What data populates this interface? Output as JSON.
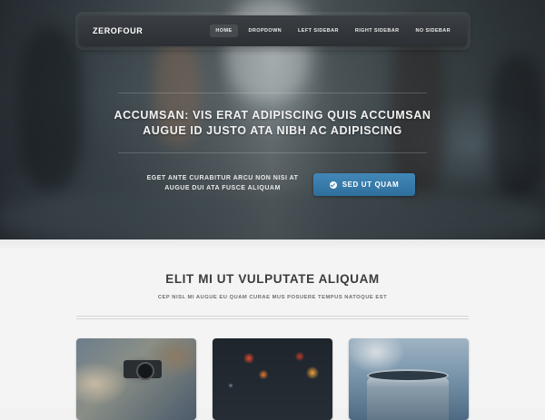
{
  "header": {
    "logo": "ZEROFOUR",
    "nav": [
      {
        "label": "HOME",
        "active": true
      },
      {
        "label": "DROPDOWN",
        "active": false
      },
      {
        "label": "LEFT SIDEBAR",
        "active": false
      },
      {
        "label": "RIGHT SIDEBAR",
        "active": false
      },
      {
        "label": "NO SIDEBAR",
        "active": false
      }
    ]
  },
  "hero": {
    "headline_line1": "ACCUMSAN: VIS ERAT ADIPISCING QUIS ACCUMSAN",
    "headline_line2": "AUGUE ID JUSTO ATA NIBH AC ADIPISCING",
    "cta_line1": "EGET ANTE CURABITUR ARCU NON NISI AT",
    "cta_line2": "AUGUE DUI ATA FUSCE ALIQUAM",
    "button_label": "SED UT QUAM",
    "button_icon": "check-circle-icon",
    "accent_color": "#3a7bab"
  },
  "main": {
    "title": "ELIT MI UT VULPUTATE ALIQUAM",
    "subtitle": "CEP NISL MI AUGUE EU QUAM CURAE MUS POSUERE TEMPUS NATOQUE EST",
    "cards": [
      {
        "image": "camera-photo"
      },
      {
        "image": "rain-window-photo"
      },
      {
        "image": "steaming-cup-photo"
      }
    ]
  }
}
